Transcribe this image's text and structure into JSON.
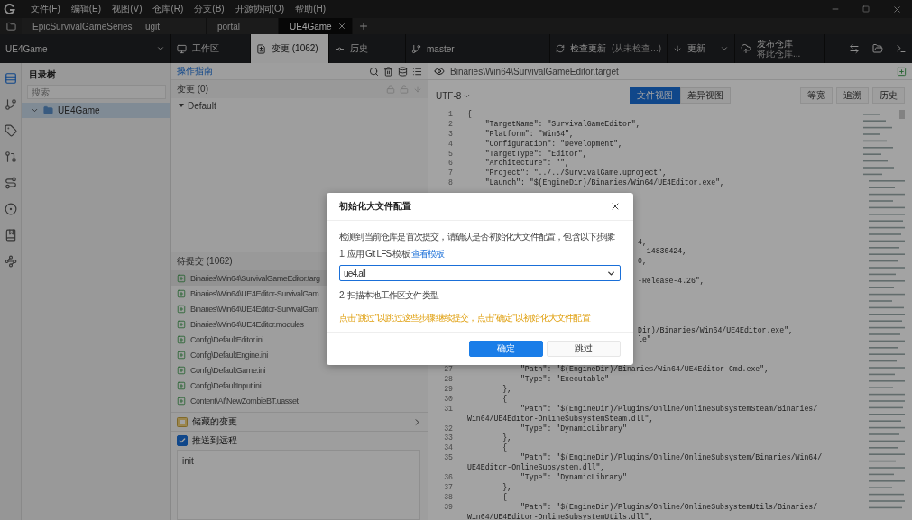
{
  "menu": [
    "文件(F)",
    "编辑(E)",
    "视图(V)",
    "仓库(R)",
    "分支(B)",
    "开源协同(O)",
    "帮助(H)"
  ],
  "tabs": [
    {
      "label": "EpicSurvivalGameSeries",
      "selected": false
    },
    {
      "label": "ugit",
      "selected": false
    },
    {
      "label": "portal",
      "selected": false
    },
    {
      "label": "UE4Game",
      "selected": true
    }
  ],
  "toolbar": {
    "repo": "UE4Game",
    "views": [
      {
        "label": "工作区",
        "selected": false
      },
      {
        "label": "变更 (1062)",
        "selected": true
      },
      {
        "label": "历史",
        "selected": false
      }
    ],
    "branch": "master",
    "check": {
      "label": "检查更新",
      "note": "(从未检查...)"
    },
    "update": "更新",
    "publish": {
      "title": "发布仓库",
      "subtitle": "将此仓库..."
    }
  },
  "activity_bar": [
    {
      "selected": true
    },
    {
      "selected": false
    },
    {
      "selected": false
    },
    {
      "selected": false
    },
    {
      "selected": false
    },
    {
      "selected": false
    },
    {
      "selected": false
    },
    {
      "selected": false
    }
  ],
  "directory_tree": {
    "title": "目录树",
    "search": {
      "placeholder": "搜索"
    },
    "items": [
      {
        "label": "UE4Game",
        "expanded": true,
        "selected": true
      }
    ]
  },
  "changes": {
    "guide_link": "操作指南",
    "changelist": "变更 (0)",
    "groups": [
      {
        "label": "Default",
        "expanded": true
      }
    ],
    "pending": {
      "title": "待提交 (1062)",
      "files": [
        {
          "path": "Binaries\\Win64\\SurvivalGameEditor.targ",
          "selected": true
        },
        {
          "path": "Binaries\\Win64\\UE4Editor-SurvivalGam",
          "selected": false
        },
        {
          "path": "Binaries\\Win64\\UE4Editor-SurvivalGam",
          "selected": false
        },
        {
          "path": "Binaries\\Win64\\UE4Editor.modules",
          "selected": false
        },
        {
          "path": "Config\\DefaultEditor.ini",
          "selected": false
        },
        {
          "path": "Config\\DefaultEngine.ini",
          "selected": false
        },
        {
          "path": "Config\\DefaultGame.ini",
          "selected": false
        },
        {
          "path": "Config\\DefaultInput.ini",
          "selected": false
        },
        {
          "path": "Content\\AI\\NewZombieBT.uasset",
          "selected": false
        }
      ]
    },
    "stash": "储藏的变更",
    "push": {
      "label": "推送到远程",
      "checked": true
    },
    "commit_message": {
      "value": "init"
    }
  },
  "file_view": {
    "path": "Binaries\\Win64\\SurvivalGameEditor.target",
    "encoding": "UTF-8",
    "view_tabs": [
      {
        "label": "文件视图",
        "selected": true
      },
      {
        "label": "差异视图",
        "selected": false
      }
    ],
    "buttons": [
      "等宽",
      "追溯",
      "历史"
    ],
    "lines": [
      {
        "kind": "full",
        "number": "1",
        "text": "{"
      },
      {
        "kind": "full",
        "number": "2",
        "text": "    \"TargetName\": \"SurvivalGameEditor\","
      },
      {
        "kind": "full",
        "number": "3",
        "text": "    \"Platform\": \"Win64\","
      },
      {
        "kind": "full",
        "number": "4",
        "text": "    \"Configuration\": \"Development\","
      },
      {
        "kind": "full",
        "number": "5",
        "text": "    \"TargetType\": \"Editor\","
      },
      {
        "kind": "full",
        "number": "6",
        "text": "    \"Architecture\": \"\","
      },
      {
        "kind": "full",
        "number": "7",
        "text": "    \"Project\": \"../../SurvivalGame.uproject\","
      },
      {
        "kind": "full",
        "number": "8",
        "text": "    \"Launch\": \"$(EngineDir)/Binaries/Win64/UE4Editor.exe\","
      },
      {
        "kind": "hidden"
      },
      {
        "kind": "hidden"
      },
      {
        "kind": "hidden"
      },
      {
        "kind": "hidden"
      },
      {
        "kind": "hidden"
      },
      {
        "kind": "partial",
        "text": "4,"
      },
      {
        "kind": "partial",
        "text": ": 14830424,"
      },
      {
        "kind": "partial",
        "text": "0,"
      },
      {
        "kind": "hidden"
      },
      {
        "kind": "partial",
        "text": "-Release-4.26\","
      },
      {
        "kind": "hidden"
      },
      {
        "kind": "hidden"
      },
      {
        "kind": "hidden"
      },
      {
        "kind": "hidden"
      },
      {
        "kind": "partial",
        "text": "Dir)/Binaries/Win64/UE4Editor.exe\","
      },
      {
        "kind": "partial",
        "text": "le\""
      },
      {
        "kind": "hidden"
      },
      {
        "kind": "hidden"
      },
      {
        "kind": "full",
        "number": "27",
        "text": "            \"Path\": \"$(EngineDir)/Binaries/Win64/UE4Editor-Cmd.exe\","
      },
      {
        "kind": "full",
        "number": "28",
        "text": "            \"Type\": \"Executable\""
      },
      {
        "kind": "full",
        "number": "29",
        "text": "        },"
      },
      {
        "kind": "full",
        "number": "30",
        "text": "        {"
      },
      {
        "kind": "full",
        "number": "31",
        "text": "            \"Path\": \"$(EngineDir)/Plugins/Online/OnlineSubsystemSteam/Binaries/",
        "continuation": "Win64/UE4Editor-OnlineSubsystemSteam.dll\","
      },
      {
        "kind": "full",
        "number": "32",
        "text": "            \"Type\": \"DynamicLibrary\""
      },
      {
        "kind": "full",
        "number": "33",
        "text": "        },"
      },
      {
        "kind": "full",
        "number": "34",
        "text": "        {"
      },
      {
        "kind": "full",
        "number": "35",
        "text": "            \"Path\": \"$(EngineDir)/Plugins/Online/OnlineSubsystem/Binaries/Win64/",
        "continuation": "UE4Editor-OnlineSubsystem.dll\","
      },
      {
        "kind": "full",
        "number": "36",
        "text": "            \"Type\": \"DynamicLibrary\""
      },
      {
        "kind": "full",
        "number": "37",
        "text": "        },"
      },
      {
        "kind": "full",
        "number": "38",
        "text": "        {"
      },
      {
        "kind": "full",
        "number": "39",
        "text": "            \"Path\": \"$(EngineDir)/Plugins/Online/OnlineSubsystemUtils/Binaries/",
        "continuation": "Win64/UE4Editor-OnlineSubsystemUtils.dll\","
      }
    ]
  },
  "dialog": {
    "title": "初始化大文件配置",
    "intro": "检测到当前仓库是首次提交，请确认是否初始化大文件配置，包含以下步骤:",
    "step1": "1. 应用 Git LFS 模板",
    "step1_link": "查看模板",
    "template": {
      "value": "ue4.all"
    },
    "step2": "2. 扫描本地工作区文件类型",
    "warning": "点击\"跳过\"以跳过这些步骤继续提交，点击\"确定\"以初始化大文件配置",
    "buttons": [
      {
        "label": "确定",
        "kind": "primary"
      },
      {
        "label": "跳过",
        "kind": "default"
      }
    ]
  }
}
